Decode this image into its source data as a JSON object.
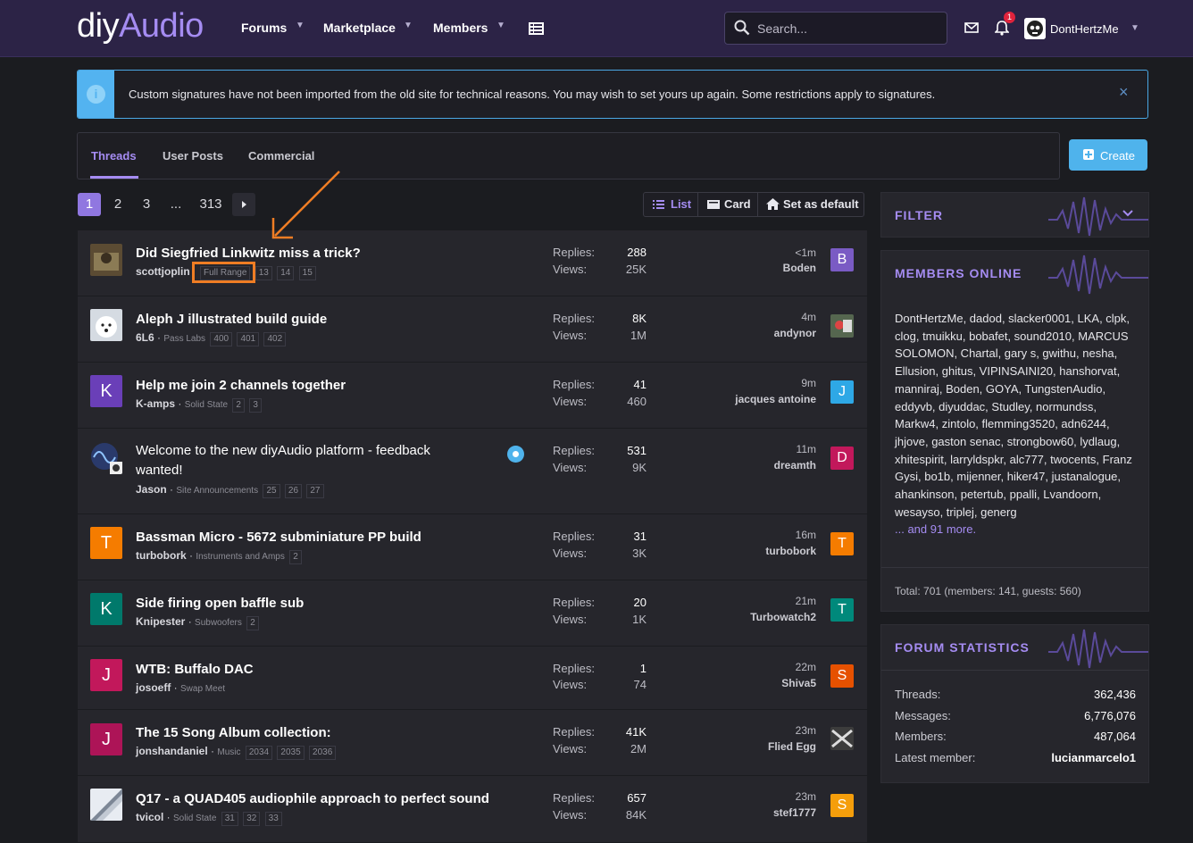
{
  "header": {
    "logo_diy": "diy",
    "logo_audio": "Audio",
    "nav": [
      "Forums",
      "Marketplace",
      "Members"
    ],
    "search_placeholder": "Search...",
    "alerts_count": "1",
    "username": "DontHertzMe"
  },
  "notice": {
    "text": "Custom signatures have not been imported from the old site for technical reasons. You may wish to set yours up again. Some restrictions apply to signatures.",
    "close": "×"
  },
  "tabs": [
    "Threads",
    "User Posts",
    "Commercial"
  ],
  "create_label": "Create",
  "pager": {
    "p1": "1",
    "p2": "2",
    "p3": "3",
    "ellipsis": "...",
    "last": "313"
  },
  "view": {
    "list": "List",
    "card": "Card",
    "default": "Set as default"
  },
  "threads": [
    {
      "title": "Did Siegfried Linkwitz miss a trick?",
      "author": "scottjoplin",
      "forum": "Full Range",
      "pages": [
        "13",
        "14",
        "15"
      ],
      "replies": "288",
      "views": "25K",
      "time": "<1m",
      "last_user": "Boden",
      "last_letter": "B",
      "last_color": "#7a5bc4",
      "avatar_letter": "",
      "avatar_color": "#6b5b3e"
    },
    {
      "title": "Aleph J illustrated build guide",
      "author": "6L6",
      "forum": "Pass Labs",
      "pages": [
        "400",
        "401",
        "402"
      ],
      "replies": "8K",
      "views": "1M",
      "time": "4m",
      "last_user": "andynor",
      "last_letter": "",
      "last_color": "#5b6e5a",
      "avatar_letter": "",
      "avatar_color": "#e9eef3"
    },
    {
      "title": "Help me join 2 channels together",
      "author": "K-amps",
      "forum": "Solid State",
      "pages": [
        "2",
        "3"
      ],
      "replies": "41",
      "views": "460",
      "time": "9m",
      "last_user": "jacques antoine",
      "last_letter": "J",
      "last_color": "#2ea8e6",
      "avatar_letter": "K",
      "avatar_color": "#6a3fb8"
    },
    {
      "title_line1": "Welcome to the new diyAudio platform - feedback",
      "title_line2": "wanted!",
      "author": "Jason",
      "forum": "Site Announcements",
      "pages": [
        "25",
        "26",
        "27"
      ],
      "replies": "531",
      "views": "9K",
      "time": "11m",
      "last_user": "dreamth",
      "last_letter": "D",
      "last_color": "#c2185b",
      "avatar_letter": "",
      "avatar_color": "#2a3a6b"
    },
    {
      "title": "Bassman Micro - 5672 subminiature PP build",
      "author": "turbobork",
      "forum": "Instruments and Amps",
      "pages": [
        "2"
      ],
      "replies": "31",
      "views": "3K",
      "time": "16m",
      "last_user": "turbobork",
      "last_letter": "T",
      "last_color": "#f57c00",
      "avatar_letter": "T",
      "avatar_color": "#f57c00"
    },
    {
      "title": "Side firing open baffle sub",
      "author": "Knipester",
      "forum": "Subwoofers",
      "pages": [
        "2"
      ],
      "replies": "20",
      "views": "1K",
      "time": "21m",
      "last_user": "Turbowatch2",
      "last_letter": "T",
      "last_color": "#00897b",
      "avatar_letter": "K",
      "avatar_color": "#00796b"
    },
    {
      "title": "WTB: Buffalo DAC",
      "author": "josoeff",
      "forum": "Swap Meet",
      "pages": [],
      "replies": "1",
      "views": "74",
      "time": "22m",
      "last_user": "Shiva5",
      "last_letter": "S",
      "last_color": "#e65100",
      "avatar_letter": "J",
      "avatar_color": "#c2185b"
    },
    {
      "title": "The 15 Song Album collection:",
      "author": "jonshandaniel",
      "forum": "Music",
      "pages": [
        "2034",
        "2035",
        "2036"
      ],
      "replies": "41K",
      "views": "2M",
      "time": "23m",
      "last_user": "Flied Egg",
      "last_letter": "",
      "last_color": "#444",
      "avatar_letter": "J",
      "avatar_color": "#ad1457"
    },
    {
      "title": "Q17 - a QUAD405 audiophile approach to perfect sound",
      "author": "tvicol",
      "forum": "Solid State",
      "pages": [
        "31",
        "32",
        "33"
      ],
      "replies": "657",
      "views": "84K",
      "time": "23m",
      "last_user": "stef1777",
      "last_letter": "S",
      "last_color": "#f59e0b",
      "avatar_letter": "",
      "avatar_color": "#9aa4b3"
    }
  ],
  "labels": {
    "replies": "Replies:",
    "views": "Views:"
  },
  "sidebar": {
    "filter": "FILTER",
    "members_online": "MEMBERS ONLINE",
    "online_list": "DontHertzMe, dadod, slacker0001, LKA, clpk, clog, tmuikku, bobafet, sound2010, MARCUS SOLOMON, Chartal, gary s, gwithu, nesha, Ellusion, ghitus, VIPINSAINI20, hanshorvat, manniraj, Boden, GOYA, TungstenAudio, eddyvb, diyuddac, Studley, normundss, Markw4, zintolo, flemming3520, adn6244, jhjove, gaston senac, strongbow60, lydlaug, xhitespirit, larryldspkr, alc777, twocents, Franz Gysi, bo1b, mijenner, hiker47, justanalogue, ahankinson, petertub, ppalli, Lvandoorn, wesayso, triplej, generg",
    "online_more": "... and 91 more.",
    "online_total": "Total: 701 (members: 141, guests: 560)",
    "forum_stats": "FORUM STATISTICS",
    "stats": [
      {
        "label": "Threads:",
        "value": "362,436"
      },
      {
        "label": "Messages:",
        "value": "6,776,076"
      },
      {
        "label": "Members:",
        "value": "487,064"
      },
      {
        "label": "Latest member:",
        "value": "lucianmarcelo1"
      }
    ]
  }
}
